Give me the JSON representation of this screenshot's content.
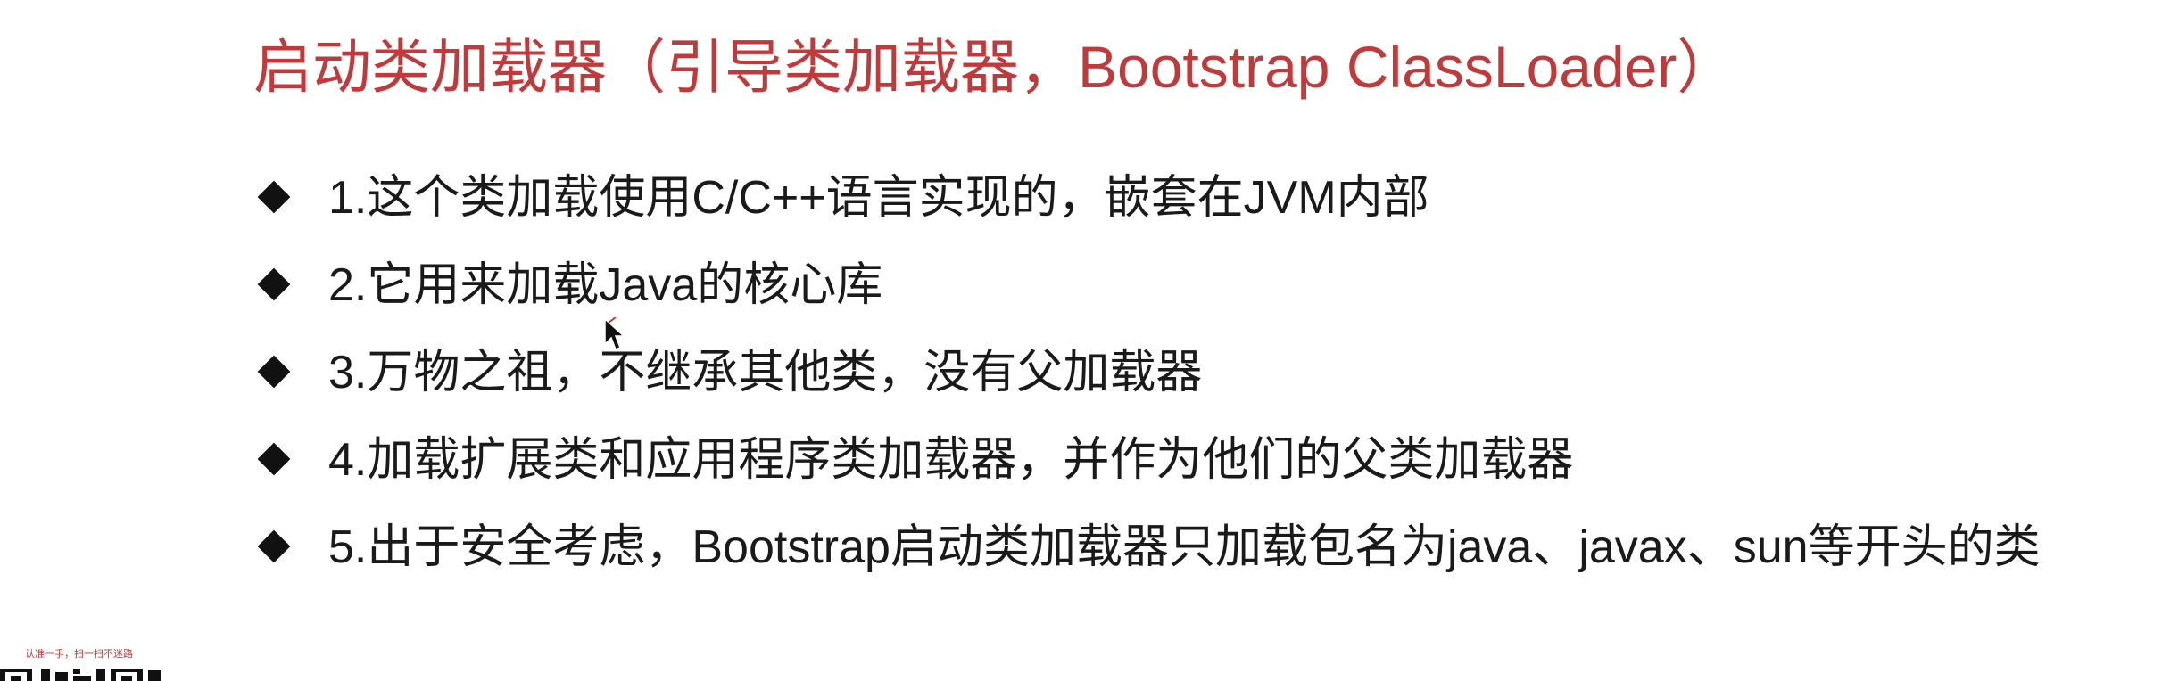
{
  "slide": {
    "title": "启动类加载器（引导类加载器，Bootstrap ClassLoader）",
    "bullets": [
      "1.这个类加载使用C/C++语言实现的，嵌套在JVM内部",
      "2.它用来加载Java的核心库",
      "3.万物之祖，不继承其他类，没有父加载器",
      "4.加载扩展类和应用程序类加载器，并作为他们的父类加载器",
      "5.出于安全考虑，Bootstrap启动类加载器只加载包名为java、javax、sun等开头的类"
    ]
  },
  "corner_badge": {
    "caption": "认准一手，扫一扫不迷路"
  },
  "colors": {
    "title": "#c0393b",
    "text": "#1a1a1a",
    "bullet": "#111111",
    "background": "#ffffff"
  },
  "icons": {
    "bullet": "diamond-bullet-icon",
    "cursor": "mouse-cursor-icon",
    "qr": "qr-code-icon"
  }
}
